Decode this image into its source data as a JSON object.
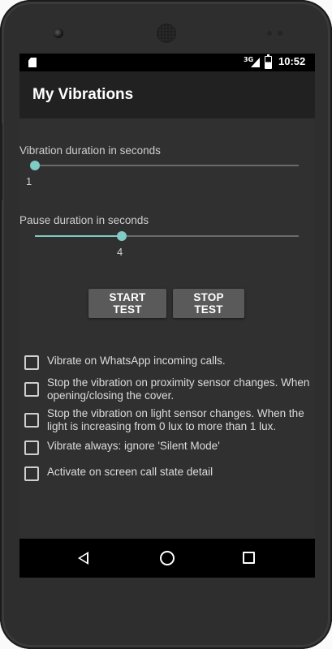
{
  "statusbar": {
    "network_label": "3G",
    "time": "10:52"
  },
  "appbar": {
    "title": "My Vibrations"
  },
  "vibration": {
    "label": "Vibration duration in seconds",
    "value": "1",
    "level_fraction": 0.0
  },
  "pause": {
    "label": "Pause duration in seconds",
    "value": "4",
    "level_fraction": 0.33
  },
  "buttons": {
    "start": "START TEST",
    "stop": "STOP TEST"
  },
  "checkboxes": [
    {
      "label": "Vibrate on WhatsApp incoming calls.",
      "checked": false
    },
    {
      "label": "Stop the vibration on proximity sensor changes. When opening/closing the cover.",
      "checked": false
    },
    {
      "label": "Stop the vibration on light sensor changes. When the light is increasing from 0 lux to more than 1 lux.",
      "checked": false
    },
    {
      "label": "Vibrate always: ignore 'Silent Mode'",
      "checked": false
    },
    {
      "label": "Activate on screen call state detail",
      "checked": false
    }
  ],
  "colors": {
    "accent": "#80cbc4",
    "appbar": "#212121",
    "background": "#303030",
    "button": "#5a5a5a"
  },
  "icons": {
    "status": [
      "sd-card-icon",
      "signal-icon",
      "battery-icon"
    ],
    "nav": [
      "back-icon",
      "home-icon",
      "recents-icon"
    ]
  }
}
